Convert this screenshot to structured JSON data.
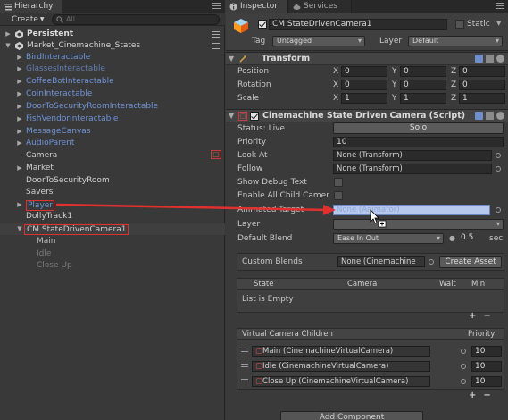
{
  "hierarchy": {
    "tab_label": "Hierarchy",
    "create_label": "Create",
    "search_placeholder": "All",
    "persistent": "Persistent",
    "scene": "Market_Cinemachine_States",
    "items": [
      "BirdInteractable",
      "GlassesInteractable",
      "CoffeeBotInteractable",
      "CoinInteractable",
      "DoorToSecurityRoomInteractable",
      "FishVendorInteractable",
      "MessageCanvas",
      "AudioParent",
      "Camera",
      "Market",
      "DoorToSecurityRoom",
      "Savers",
      "Player",
      "DollyTrack1",
      "CM StateDrivenCamera1",
      "Main",
      "Idle",
      "Close Up"
    ]
  },
  "inspector": {
    "tab_label": "Inspector",
    "services_label": "Services",
    "object_name": "CM StateDrivenCamera1",
    "static_label": "Static",
    "tag_label": "Tag",
    "tag_value": "Untagged",
    "layer_label": "Layer",
    "layer_value": "Default",
    "transform": {
      "title": "Transform",
      "rows": [
        {
          "label": "Position",
          "x": "0",
          "y": "0",
          "z": "0"
        },
        {
          "label": "Rotation",
          "x": "0",
          "y": "0",
          "z": "0"
        },
        {
          "label": "Scale",
          "x": "1",
          "y": "1",
          "z": "1"
        }
      ],
      "axis_x": "X",
      "axis_y": "Y",
      "axis_z": "Z"
    },
    "script": {
      "title": "Cinemachine State Driven Camera (Script)",
      "status_label": "Status: Live",
      "solo_label": "Solo",
      "priority_label": "Priority",
      "priority_value": "10",
      "lookat_label": "Look At",
      "lookat_value": "None (Transform)",
      "follow_label": "Follow",
      "follow_value": "None (Transform)",
      "debug_label": "Show Debug Text",
      "enable_children_label": "Enable All Child Camer",
      "animated_target_label": "Animated Target",
      "animated_target_value": "None (Animator)",
      "layer_label": "Layer",
      "default_blend_label": "Default Blend",
      "default_blend_value": "Ease In Out",
      "blend_time": "0.5",
      "blend_unit": "sec",
      "custom_blends_label": "Custom Blends",
      "custom_blends_value": "None (Cinemachine",
      "create_asset_label": "Create Asset",
      "states_headers": {
        "state": "State",
        "camera": "Camera",
        "wait": "Wait",
        "min": "Min"
      },
      "list_empty": "List is Empty",
      "children_header": "Virtual Camera Children",
      "children_priority_header": "Priority",
      "children": [
        {
          "name": "Main (CinemachineVirtualCamera)",
          "priority": "10"
        },
        {
          "name": "Idle (CinemachineVirtualCamera)",
          "priority": "10"
        },
        {
          "name": "Close Up (CinemachineVirtualCamera)",
          "priority": "10"
        }
      ]
    },
    "add_component_label": "Add Component"
  },
  "colors": {
    "highlight": "#e0312f",
    "prefab_text": "#6f93d8",
    "selection_field": "#b7c8ef"
  }
}
